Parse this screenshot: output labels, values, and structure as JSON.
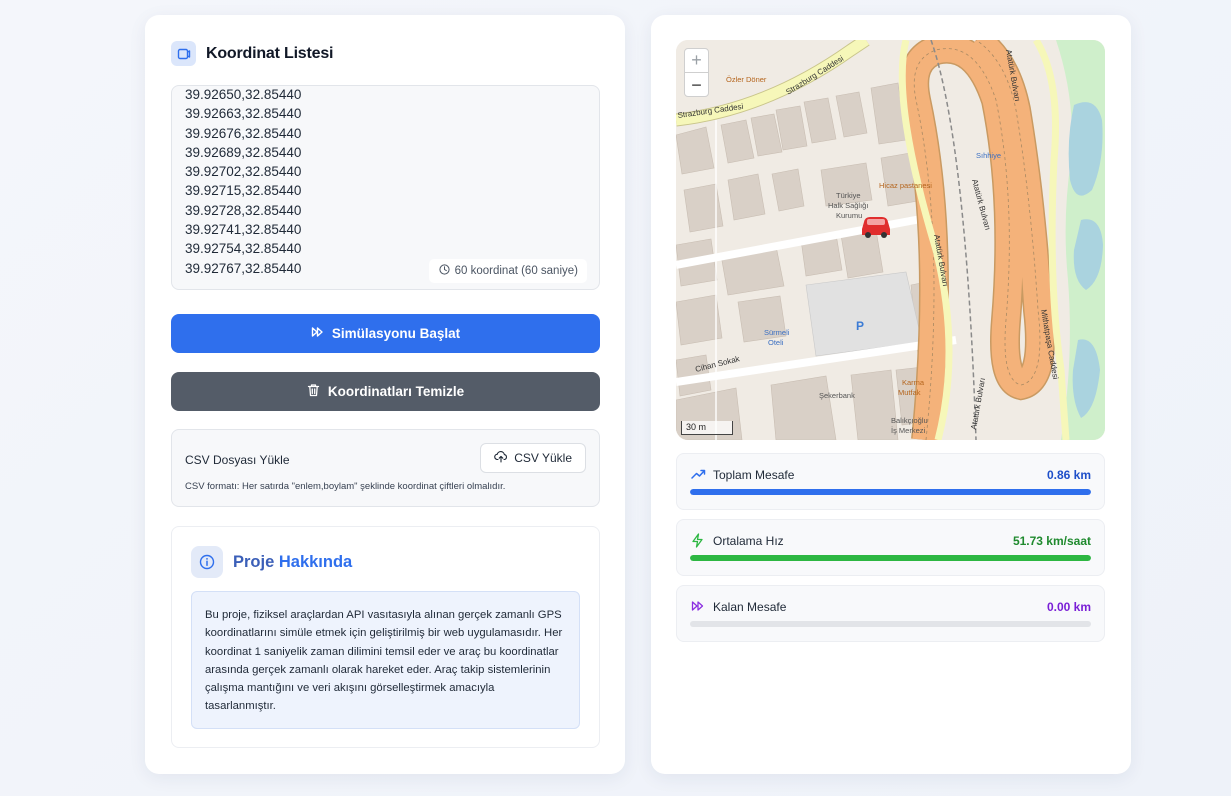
{
  "coord_panel": {
    "title": "Koordinat Listesi",
    "coordinates": [
      "39.92650,32.85440",
      "39.92663,32.85440",
      "39.92676,32.85440",
      "39.92689,32.85440",
      "39.92702,32.85440",
      "39.92715,32.85440",
      "39.92728,32.85440",
      "39.92741,32.85440",
      "39.92754,32.85440",
      "39.92767,32.85440"
    ],
    "count_label": "60 koordinat (60 saniye)"
  },
  "actions": {
    "start_label": "Simülasyonu Başlat",
    "clear_label": "Koordinatları Temizle"
  },
  "csv": {
    "label": "CSV Dosyası Yükle",
    "button_label": "CSV Yükle",
    "help": "CSV formatı: Her satırda \"enlem,boylam\" şeklinde koordinat çiftleri olmalıdır."
  },
  "about": {
    "title_part1": "Proje ",
    "title_part2": "Hakkında",
    "text": "Bu proje, fiziksel araçlardan API vasıtasıyla alınan gerçek zamanlı GPS koordinatlarını simüle etmek için geliştirilmiş bir web uygulamasıdır. Her koordinat 1 saniyelik zaman dilimini temsil eder ve araç bu koordinatlar arasında gerçek zamanlı olarak hareket eder. Araç takip sistemlerinin çalışma mantığını ve veri akışını görselleştirmek amacıyla tasarlanmıştır."
  },
  "map": {
    "zoom_in": "+",
    "zoom_out": "−",
    "scale": "30 m",
    "labels": {
      "street_strazburg": "Strazburg Caddesi",
      "street_strazburg2": "Strazburg Caddesi",
      "street_ataturk1": "Atatürk Bulvarı",
      "street_ataturk2": "Atatürk Bulvarı",
      "street_ataturk3": "Atatürk Bulvarı",
      "street_ataturk4": "Atatürk Bulvarı",
      "street_mithatpasa": "Mithatpaşa Caddesi",
      "street_cihan": "Cihan Sokak",
      "poi_ozler": "Özler Döner",
      "poi_sihhiye": "Sıhhiye",
      "poi_hicaz": "Hicaz pastanesi",
      "poi_halk_sagligi": "Türkiye Halk Sağlığı Kurumu",
      "poi_surmeli": "Sürmeli Oteli",
      "poi_sekerbank": "Şekerbank",
      "poi_karma": "Karma Mutfak",
      "poi_balikcioglu": "Balıkçıoğlu İş Merkezi",
      "parking": "P"
    },
    "colors": {
      "motorway": "#f4b27a",
      "primary_road": "#f6f7b9",
      "park": "#c9eec6",
      "water": "#aad3df",
      "building": "#d7cfc5"
    },
    "vehicle_icon": "car-icon"
  },
  "stats": {
    "distance": {
      "label": "Toplam Mesafe",
      "value": "0.86 km",
      "progress": 1.0,
      "color": "#2f6fed"
    },
    "speed": {
      "label": "Ortalama Hız",
      "value": "51.73 km/saat",
      "progress": 1.0,
      "color": "#2db742"
    },
    "remaining": {
      "label": "Kalan Mesafe",
      "value": "0.00 km",
      "progress": 0.0,
      "color": "#8b2fe0"
    }
  }
}
